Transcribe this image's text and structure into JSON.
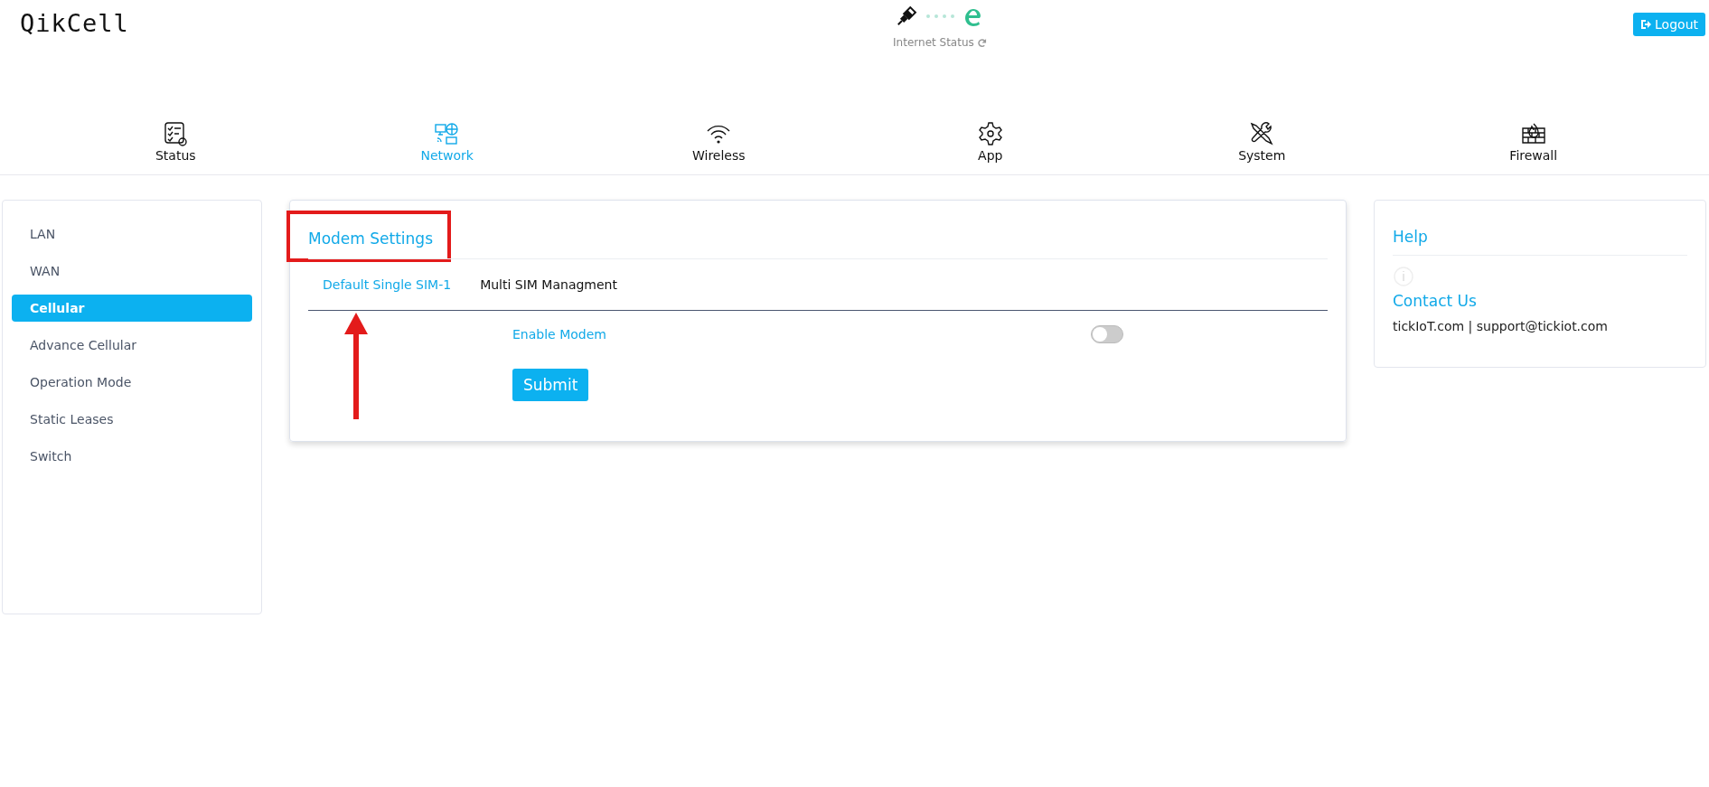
{
  "header": {
    "logo": "QikCell",
    "internet_status": "Internet Status",
    "logout": "Logout"
  },
  "nav": [
    {
      "label": "Status",
      "kind": "checklist",
      "selected": false
    },
    {
      "label": "Network",
      "kind": "network",
      "selected": true
    },
    {
      "label": "Wireless",
      "kind": "wifi",
      "selected": false
    },
    {
      "label": "App",
      "kind": "gear",
      "selected": false
    },
    {
      "label": "System",
      "kind": "tools",
      "selected": false
    },
    {
      "label": "Firewall",
      "kind": "firewall",
      "selected": false
    }
  ],
  "sidebar": {
    "items": [
      {
        "label": "LAN",
        "selected": false
      },
      {
        "label": "WAN",
        "selected": false
      },
      {
        "label": "Cellular",
        "selected": true
      },
      {
        "label": "Advance Cellular",
        "selected": false
      },
      {
        "label": "Operation Mode",
        "selected": false
      },
      {
        "label": "Static Leases",
        "selected": false
      },
      {
        "label": "Switch",
        "selected": false
      }
    ]
  },
  "panel": {
    "title": "Modem Settings",
    "tabs": [
      {
        "label": "Default Single SIM-1",
        "selected": true
      },
      {
        "label": "Multi SIM Managment",
        "selected": false
      }
    ],
    "fields": [
      {
        "label": "Enable Modem",
        "on": false
      }
    ],
    "submit": "Submit"
  },
  "help": {
    "title": "Help",
    "contact_title": "Contact Us",
    "contact_text": "tickIoT.com | support@tickiot.com"
  }
}
